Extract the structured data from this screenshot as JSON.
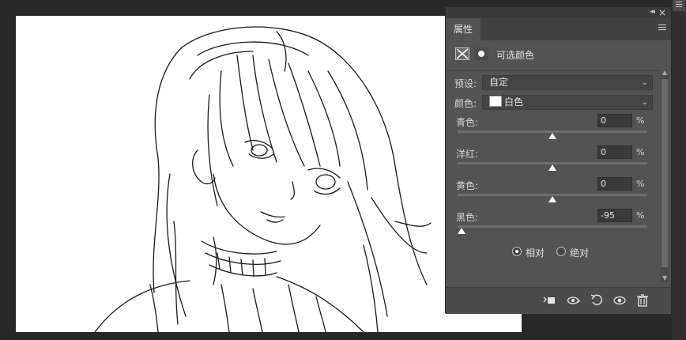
{
  "panel": {
    "tab_label": "属性",
    "collapse_glyph": "◂◂",
    "close_glyph": "×",
    "adjustment_title": "可选颜色",
    "preset": {
      "label": "预设:",
      "value": "自定"
    },
    "colors": {
      "label": "颜色:",
      "value": "白色",
      "swatch_color": "#ffffff"
    },
    "sliders": [
      {
        "label": "青色:",
        "value": "0",
        "unit": "%",
        "position": 0.0
      },
      {
        "label": "洋红:",
        "value": "0",
        "unit": "%",
        "position": 0.0
      },
      {
        "label": "黄色:",
        "value": "0",
        "unit": "%",
        "position": 0.0
      },
      {
        "label": "黑色:",
        "value": "-95",
        "unit": "%",
        "position": -95
      }
    ],
    "mode": {
      "options": [
        {
          "label": "相对",
          "selected": true
        },
        {
          "label": "绝对",
          "selected": false
        }
      ]
    },
    "bottom_icons": [
      "clip-to-layer-icon",
      "view-previous-icon",
      "reset-icon",
      "visibility-eye-icon",
      "trash-icon"
    ]
  },
  "colors": {
    "panel_bg": "#535353",
    "app_bg": "#282828",
    "canvas": "#ffffff",
    "accent_text": "#e0e0e0"
  }
}
